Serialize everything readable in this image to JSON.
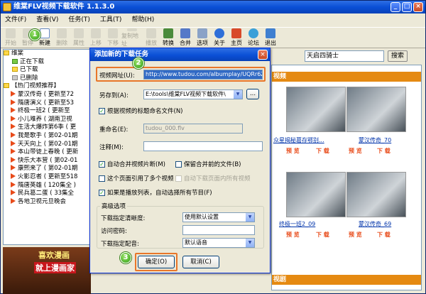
{
  "app": {
    "title": "维棠FLV视频下载软件 1.1.3.0"
  },
  "menu": [
    "文件(F)",
    "查看(V)",
    "任务(T)",
    "工具(T)",
    "帮助(H)"
  ],
  "toolbar": [
    "开始",
    "暂停",
    "新建",
    "删除",
    "属性",
    "上移",
    "下移",
    "复制地址",
    "播放",
    "转换",
    "合并",
    "选项",
    "关于",
    "主页",
    "论坛",
    "退出"
  ],
  "search": {
    "value": "天启四骑士",
    "button": "搜索"
  },
  "tree": {
    "root": "维棠",
    "items": [
      "正在下载",
      "已下载",
      "已删除",
      "【热门视频推荐】",
      "蒙汉传奇 ( 更新至72",
      "隋唐演义 ( 更新至53",
      "终极一班2 ( 更新至",
      "小儿难养 ( 湖南卫视",
      "生活大爆炸第6季 ( 更",
      "我是歌手 ( 第02-01期",
      "天天向上 ( 第02-01期",
      "本山带徒上春晚 ( 更新",
      "快乐大本营 ( 第02-01",
      "康熙来了 ( 第02-01期",
      "火影忍者 ( 更新至518",
      "隋唐英雄 ( 120集全 )",
      "民兵葛二蛋 ( 33集全",
      "各地卫视元旦晚会"
    ]
  },
  "banner": {
    "line1": "喜欢漫画",
    "line2": "就上漫画家"
  },
  "web": {
    "header1": "视频",
    "header2": "视剧",
    "videos": [
      {
        "caption": "众星揭秘葛存鄂别..."
      },
      {
        "caption": "蒙汉传奇_70"
      },
      {
        "caption": "终极一班2_09"
      },
      {
        "caption": "蒙汉传奇_69"
      }
    ],
    "preview": "预 览",
    "download": "下 载"
  },
  "dialog": {
    "title": "添加新的下载任务",
    "url_label": "视频网址(U):",
    "url_value": "http://www.tudou.com/albumplay/UQRr6Z",
    "saveas_label": "另存到(A):",
    "saveas_value": "E:\\tools\\维棠FLV视频下载软件\\",
    "browse": "...",
    "rename_by_title": "根据视频的标题命名文件(N)",
    "rename_label": "重命名(E):",
    "rename_value": "tudou_000.flv",
    "note_label": "注释(M):",
    "note_value": "",
    "auto_merge": "自动合并视频片断(M)",
    "keep_before_merge": "保留合并前的文件(B)",
    "multi_video": "这个页面引用了多个视频",
    "auto_download_all": "自动下载页面内所有视频",
    "playlist": "如果是播放列表，自动选择所有节目(F)",
    "advanced": "高级选项",
    "clarity_label": "下载指定清晰度:",
    "clarity_value": "使用默认设置",
    "password_label": "访问密码:",
    "password_value": "",
    "dub_label": "下载指定配音:",
    "dub_value": "默认语音",
    "ok": "确定(O)",
    "cancel": "取消(C)"
  },
  "badges": [
    "1",
    "2",
    "3"
  ]
}
